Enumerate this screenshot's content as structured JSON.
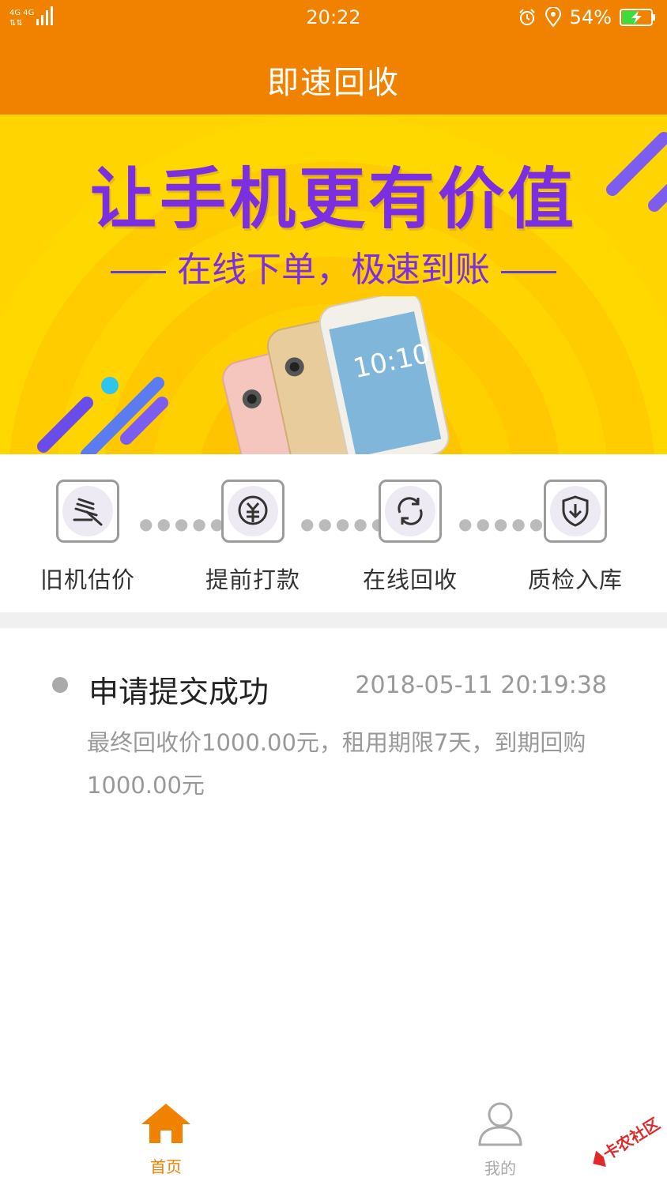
{
  "status_bar": {
    "signal_text": "4G 4G",
    "time": "20:22",
    "battery_percent": "54%",
    "battery_level": 0.54,
    "icons": [
      "signal-icon",
      "alarm-icon",
      "location-icon",
      "battery-charging-icon"
    ]
  },
  "header": {
    "title": "即速回收"
  },
  "banner": {
    "headline": "让手机更有价值",
    "subline": "在线下单，极速到账",
    "phone_screen_time": "10:10",
    "colors": {
      "background": "#ffd400",
      "text": "#7b2fe0"
    }
  },
  "steps": [
    {
      "label": "旧机估价",
      "icon": "gavel-icon"
    },
    {
      "label": "提前打款",
      "icon": "yen-payment-icon"
    },
    {
      "label": "在线回收",
      "icon": "refresh-cycle-icon"
    },
    {
      "label": "质检入库",
      "icon": "shield-download-icon"
    }
  ],
  "record": {
    "status": "申请提交成功",
    "time": "2018-05-11 20:19:38",
    "description": "最终回收价1000.00元，租用期限7天，到期回购1000.00元"
  },
  "bottom_nav": {
    "home_label": "首页",
    "mine_label": "我的",
    "active": "home",
    "colors": {
      "active": "#f08200",
      "inactive": "#aaaaaa"
    }
  },
  "watermark": {
    "text": "卡农社区"
  },
  "colors": {
    "primary": "#f08200",
    "divider": "#f0f0f0"
  }
}
